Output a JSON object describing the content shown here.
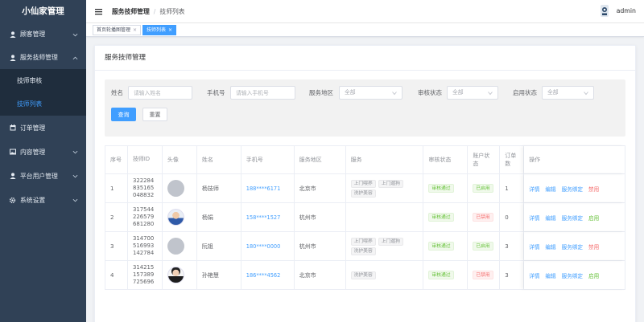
{
  "sidebar": {
    "brand": "小仙家管理",
    "menu": [
      {
        "label": "顾客管理",
        "icon": "user-icon"
      },
      {
        "label": "服务技师管理",
        "icon": "user-icon"
      },
      {
        "label": "订单管理",
        "icon": "calendar-icon"
      },
      {
        "label": "内容管理",
        "icon": "image-icon"
      },
      {
        "label": "平台用户管理",
        "icon": "user-icon"
      },
      {
        "label": "系统设置",
        "icon": "gear-icon"
      }
    ],
    "sub_items": [
      {
        "label": "技师审核",
        "active": false
      },
      {
        "label": "技师列表",
        "active": true
      }
    ]
  },
  "header": {
    "breadcrumb": [
      "服务技师管理",
      "技师列表"
    ],
    "separator": "/",
    "user": "admin"
  },
  "tags": [
    {
      "label": "首页轮播图管理",
      "close": "×",
      "active": false
    },
    {
      "label": "技师列表",
      "close": "×",
      "active": true
    }
  ],
  "card": {
    "title": "服务技师管理"
  },
  "filter": {
    "name_label": "姓名",
    "name_placeholder": "请输入姓名",
    "phone_label": "手机号",
    "phone_placeholder": "请输入手机号",
    "area_label": "服务地区",
    "area_value": "全部",
    "audit_label": "审核状态",
    "audit_value": "全部",
    "enable_label": "启用状态",
    "enable_value": "全部",
    "search_btn": "查询",
    "reset_btn": "重置"
  },
  "table": {
    "headers": [
      "序号",
      "技师ID",
      "头像",
      "姓名",
      "手机号",
      "服务地区",
      "服务",
      "审核状态",
      "账户状态",
      "订单数",
      "操作"
    ],
    "rows": [
      {
        "no": "1",
        "id": "322284835165048832",
        "avatar": "placeholder",
        "name": "杨技师",
        "phone": "188****6171",
        "area": "北京市",
        "services": [
          "上门喂养",
          "上门遛狗",
          "洗护美容"
        ],
        "audit": "审核通过",
        "account": "已启用",
        "account_color": "#67c23a",
        "orders": "1",
        "ops": [
          "详情",
          "编辑",
          "服务绑定",
          "禁用"
        ],
        "toggle_color": "#f56c6c"
      },
      {
        "no": "2",
        "id": "317544226579681280",
        "avatar": "photo",
        "name": "杨娟",
        "phone": "158****1527",
        "area": "杭州市",
        "services": [],
        "audit": "审核通过",
        "account": "已禁用",
        "account_color": "#f56c6c",
        "orders": "0",
        "ops": [
          "详情",
          "编辑",
          "服务绑定",
          "启用"
        ],
        "toggle_color": "#67c23a"
      },
      {
        "no": "3",
        "id": "314700516993142784",
        "avatar": "placeholder",
        "name": "阮姐",
        "phone": "180****0000",
        "area": "杭州市",
        "services": [
          "上门喂养",
          "上门遛狗",
          "洗护美容"
        ],
        "audit": "审核通过",
        "account": "已启用",
        "account_color": "#67c23a",
        "orders": "3",
        "ops": [
          "详情",
          "编辑",
          "服务绑定",
          "禁用"
        ],
        "toggle_color": "#f56c6c"
      },
      {
        "no": "4",
        "id": "314215157389725696",
        "avatar": "photo2",
        "name": "孙艳慧",
        "phone": "186****4562",
        "area": "北京市",
        "services": [
          "洗护美容"
        ],
        "audit": "审核通过",
        "account": "已禁用",
        "account_color": "#f56c6c",
        "orders": "3",
        "ops": [
          "详情",
          "编辑",
          "服务绑定",
          "启用"
        ],
        "toggle_color": "#67c23a"
      }
    ]
  },
  "colors": {
    "sidebar_bg": "#304156",
    "submenu_bg": "#1f2d3d",
    "primary": "#409eff",
    "success": "#67c23a",
    "danger": "#f56c6c"
  }
}
